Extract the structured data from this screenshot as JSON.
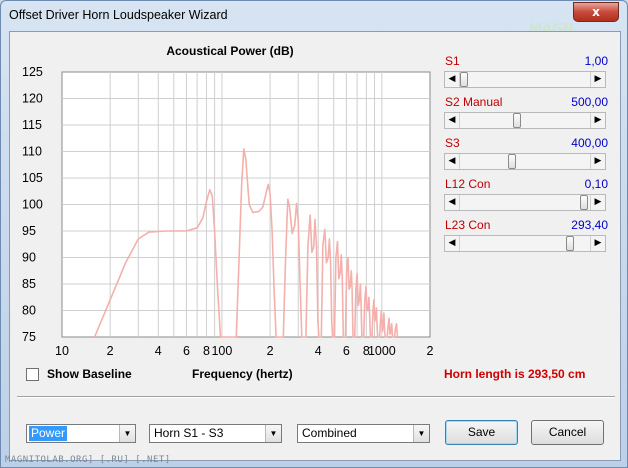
{
  "window": {
    "title": "Offset Driver Horn Loudspeaker Wizard",
    "close_glyph": "x",
    "brand_logo": "MAGNETOLAB CarAudio Team"
  },
  "chart": {
    "title": "Acoustical Power (dB)",
    "xlabel": "Frequency (hertz)",
    "y_ticks": [
      "125",
      "120",
      "115",
      "110",
      "105",
      "100",
      "95",
      "90",
      "85",
      "80",
      "75"
    ],
    "x_ticks": [
      "10",
      "2",
      "4",
      "6",
      "8",
      "100",
      "2",
      "4",
      "6",
      "8",
      "1000",
      "2"
    ]
  },
  "chart_data": {
    "type": "line",
    "title": "Acoustical Power (dB)",
    "xlabel": "Frequency (hertz)",
    "ylabel": "",
    "x_scale": "log",
    "xlim": [
      10,
      2000
    ],
    "ylim": [
      75,
      125
    ],
    "grid": true,
    "series": [
      {
        "color": "#f4b0ac",
        "points": [
          [
            16,
            75
          ],
          [
            20,
            82
          ],
          [
            25,
            89
          ],
          [
            30,
            93.5
          ],
          [
            35,
            94.8
          ],
          [
            45,
            95
          ],
          [
            60,
            95
          ],
          [
            70,
            95.6
          ],
          [
            76,
            97.5
          ],
          [
            80,
            100.5
          ],
          [
            84,
            102.8
          ],
          [
            87,
            101.5
          ],
          [
            90,
            95
          ],
          [
            94,
            84
          ],
          [
            98,
            75
          ],
          [
            123,
            75
          ],
          [
            128,
            90
          ],
          [
            133,
            104
          ],
          [
            137,
            110.5
          ],
          [
            141,
            108.5
          ],
          [
            148,
            100
          ],
          [
            156,
            98.5
          ],
          [
            170,
            98.7
          ],
          [
            180,
            99.5
          ],
          [
            190,
            102.5
          ],
          [
            195,
            103.8
          ],
          [
            200,
            102
          ],
          [
            206,
            95
          ],
          [
            212,
            84
          ],
          [
            218,
            75
          ],
          [
            242,
            75
          ],
          [
            250,
            90
          ],
          [
            258,
            101
          ],
          [
            265,
            99.5
          ],
          [
            275,
            94.5
          ],
          [
            285,
            96
          ],
          [
            293,
            100.2
          ],
          [
            300,
            97
          ],
          [
            308,
            85
          ],
          [
            316,
            75
          ],
          [
            335,
            75
          ],
          [
            345,
            92
          ],
          [
            356,
            98
          ],
          [
            365,
            91
          ],
          [
            375,
            92
          ],
          [
            382,
            97.2
          ],
          [
            390,
            92
          ],
          [
            398,
            78
          ],
          [
            404,
            75
          ],
          [
            418,
            75
          ],
          [
            428,
            92.5
          ],
          [
            440,
            95.3
          ],
          [
            450,
            89
          ],
          [
            462,
            90
          ],
          [
            470,
            93.5
          ],
          [
            478,
            89
          ],
          [
            486,
            78
          ],
          [
            492,
            75
          ],
          [
            506,
            75
          ],
          [
            516,
            90
          ],
          [
            528,
            93
          ],
          [
            538,
            86
          ],
          [
            548,
            87
          ],
          [
            558,
            90.5
          ],
          [
            566,
            86
          ],
          [
            574,
            75
          ],
          [
            592,
            75
          ],
          [
            602,
            87
          ],
          [
            614,
            90
          ],
          [
            624,
            84
          ],
          [
            634,
            84.5
          ],
          [
            644,
            87.5
          ],
          [
            652,
            84
          ],
          [
            660,
            75
          ],
          [
            676,
            75
          ],
          [
            688,
            84
          ],
          [
            700,
            87
          ],
          [
            712,
            81
          ],
          [
            724,
            82
          ],
          [
            734,
            85
          ],
          [
            742,
            81
          ],
          [
            750,
            75
          ],
          [
            770,
            75
          ],
          [
            782,
            82
          ],
          [
            796,
            84.5
          ],
          [
            808,
            80
          ],
          [
            820,
            80
          ],
          [
            830,
            82.5
          ],
          [
            840,
            79
          ],
          [
            848,
            75
          ],
          [
            868,
            75
          ],
          [
            880,
            80
          ],
          [
            892,
            82
          ],
          [
            904,
            78
          ],
          [
            914,
            78.5
          ],
          [
            924,
            80.5
          ],
          [
            934,
            77
          ],
          [
            942,
            75
          ],
          [
            968,
            75
          ],
          [
            980,
            78
          ],
          [
            994,
            80
          ],
          [
            1006,
            76
          ],
          [
            1018,
            77
          ],
          [
            1030,
            79.5
          ],
          [
            1040,
            76
          ],
          [
            1050,
            75
          ],
          [
            1080,
            75
          ],
          [
            1094,
            77
          ],
          [
            1110,
            78.5
          ],
          [
            1124,
            75.5
          ],
          [
            1138,
            76
          ],
          [
            1152,
            77.5
          ],
          [
            1166,
            75
          ],
          [
            1200,
            75
          ],
          [
            1216,
            76.5
          ],
          [
            1234,
            77.5
          ],
          [
            1252,
            75
          ]
        ]
      }
    ]
  },
  "sliders": [
    {
      "label": "S1",
      "value": "1,00",
      "position": 0.0
    },
    {
      "label": "S2  Manual",
      "value": "500,00",
      "position": 0.44
    },
    {
      "label": "S3",
      "value": "400,00",
      "position": 0.4
    },
    {
      "label": "L12  Con",
      "value": "0,10",
      "position": 1.0
    },
    {
      "label": "L23  Con",
      "value": "293,40",
      "position": 0.88
    }
  ],
  "checkbox": {
    "label": "Show Baseline",
    "checked": false
  },
  "horn_length": "Horn length is 293,50 cm",
  "combos": [
    {
      "value": "Power",
      "selected": true
    },
    {
      "value": "Horn S1 - S3",
      "selected": false
    },
    {
      "value": "Combined",
      "selected": false
    }
  ],
  "buttons": {
    "save": "Save",
    "cancel": "Cancel"
  },
  "status_strip": "MAGNITOLAB.ORG] [.RU] [.NET]",
  "colors": {
    "curve": "#f4b0ac",
    "grid": "#c8c8c8",
    "label_red": "#c00000",
    "value_blue": "#0000c8"
  }
}
